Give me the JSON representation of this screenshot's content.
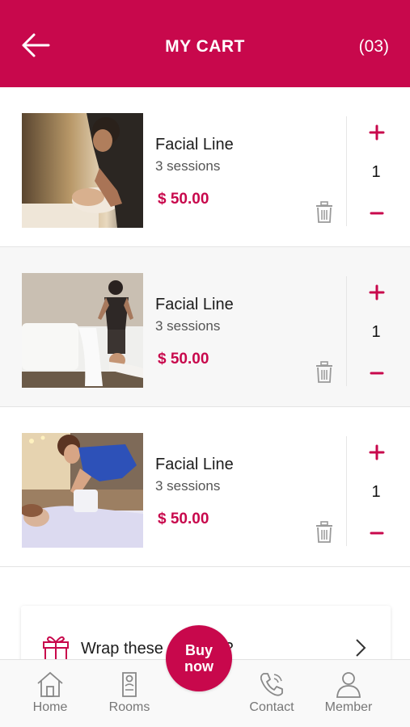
{
  "header": {
    "title": "MY CART",
    "count": "(03)"
  },
  "items": [
    {
      "name": "Facial Line",
      "sessions": "3 sessions",
      "price": "$ 50.00",
      "quantity": "1",
      "image": "facial-treatment-photo"
    },
    {
      "name": "Facial Line",
      "sessions": "3 sessions",
      "price": "$ 50.00",
      "quantity": "1",
      "image": "spa-therapist-photo"
    },
    {
      "name": "Facial Line",
      "sessions": "3 sessions",
      "price": "$ 50.00",
      "quantity": "1",
      "image": "massage-treatment-photo"
    }
  ],
  "gift": {
    "label": "Wrap these as a gift?"
  },
  "buy_now": {
    "line1": "Buy",
    "line2": "now"
  },
  "nav": [
    {
      "label": "Home",
      "icon": "home-icon"
    },
    {
      "label": "Rooms",
      "icon": "door-hanger-icon"
    },
    {
      "label": "Contact",
      "icon": "phone-icon"
    },
    {
      "label": "Member",
      "icon": "user-icon"
    }
  ],
  "colors": {
    "accent": "#c8084c",
    "background": "#ffffff",
    "shaded_row": "#f7f7f7"
  }
}
